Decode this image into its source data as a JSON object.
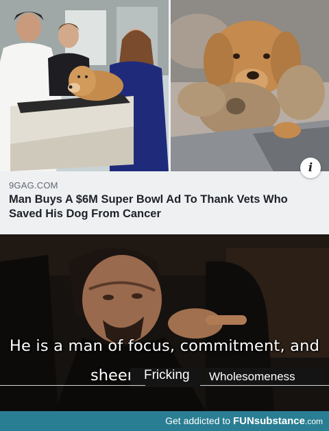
{
  "card": {
    "source": "9GAG.COM",
    "headline": "Man Buys A $6M Super Bowl Ad To Thank Vets Who Saved His Dog From Cancer",
    "info_icon": "i"
  },
  "meme": {
    "line1": "He is a man of focus, commitment, and",
    "line2_sheer": "sheeı",
    "line2_edit1": "Fricking",
    "line2_edit2": "Wholesomeness"
  },
  "footer": {
    "prefix": "Get addicted to ",
    "brand": "FUNsubstance",
    "suffix": ".com"
  },
  "colors": {
    "footer_bg": "#2a7e93",
    "card_bg": "#eef0f2",
    "headline": "#1d2129"
  }
}
